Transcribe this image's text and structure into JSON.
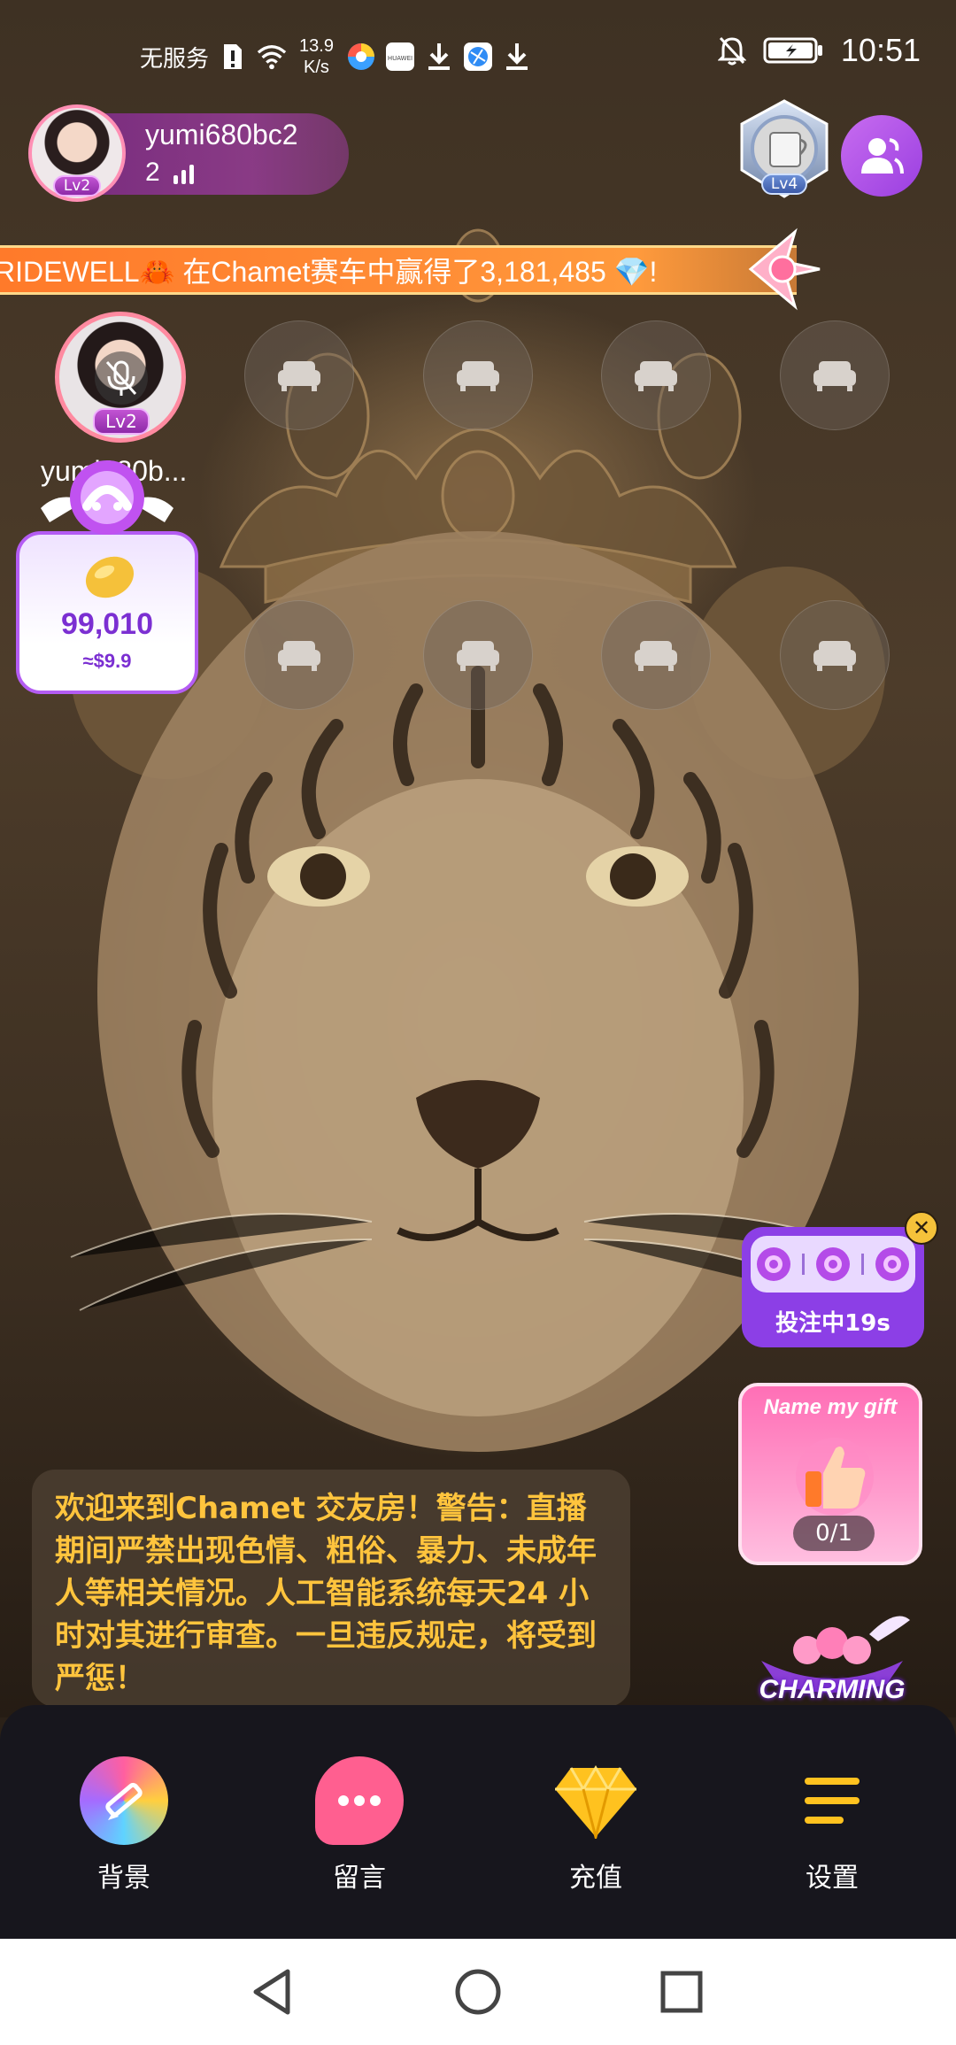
{
  "status_bar": {
    "carrier": "无服务",
    "net_speed_value": "13.9",
    "net_speed_unit": "K/s",
    "time": "10:51",
    "icons": [
      "sim-alert-icon",
      "wifi-icon",
      "browser-icon",
      "huawei-app-icon",
      "download-icon",
      "app-icon",
      "download-icon",
      "mute-bell-icon",
      "battery-charging-icon"
    ]
  },
  "host": {
    "name": "yumi680bc2",
    "level": "Lv2",
    "online_count": "2"
  },
  "room_badge": {
    "level": "Lv4"
  },
  "marquee": {
    "text": "RIDEWELL🦀 在Chamet赛车中赢得了3,181,485 💎!"
  },
  "seats": {
    "main": {
      "name": "yumi680b...",
      "level": "Lv2",
      "muted": true
    },
    "empty_count": 8
  },
  "coin_card": {
    "amount": "99,010",
    "usd": "≈$9.9"
  },
  "bet_widget": {
    "label": "投注中19s"
  },
  "gift_card": {
    "title": "Name my gift",
    "progress_text": "0/1",
    "progress": 0.0
  },
  "charming": {
    "label": "CHARMING"
  },
  "notice": {
    "text": "欢迎来到Chamet 交友房！警告：直播期间严禁出现色情、粗俗、暴力、未成年人等相关情况。人工智能系统每天24 小时对其进行审查。一旦违反规定，将受到严惩！"
  },
  "toolbar": {
    "items": [
      {
        "label": "背景",
        "icon": "background-brush-icon"
      },
      {
        "label": "留言",
        "icon": "message-bubble-icon"
      },
      {
        "label": "充值",
        "icon": "diamond-icon"
      },
      {
        "label": "设置",
        "icon": "menu-lines-icon"
      }
    ]
  },
  "navbar": {
    "buttons": [
      "back-icon",
      "home-icon",
      "recents-icon"
    ]
  },
  "colors": {
    "accent_purple": "#8c3fe6",
    "notice_text": "#ffc43d",
    "marquee_orange": "#ff8b35",
    "toolbar_bg": "#17161d"
  }
}
